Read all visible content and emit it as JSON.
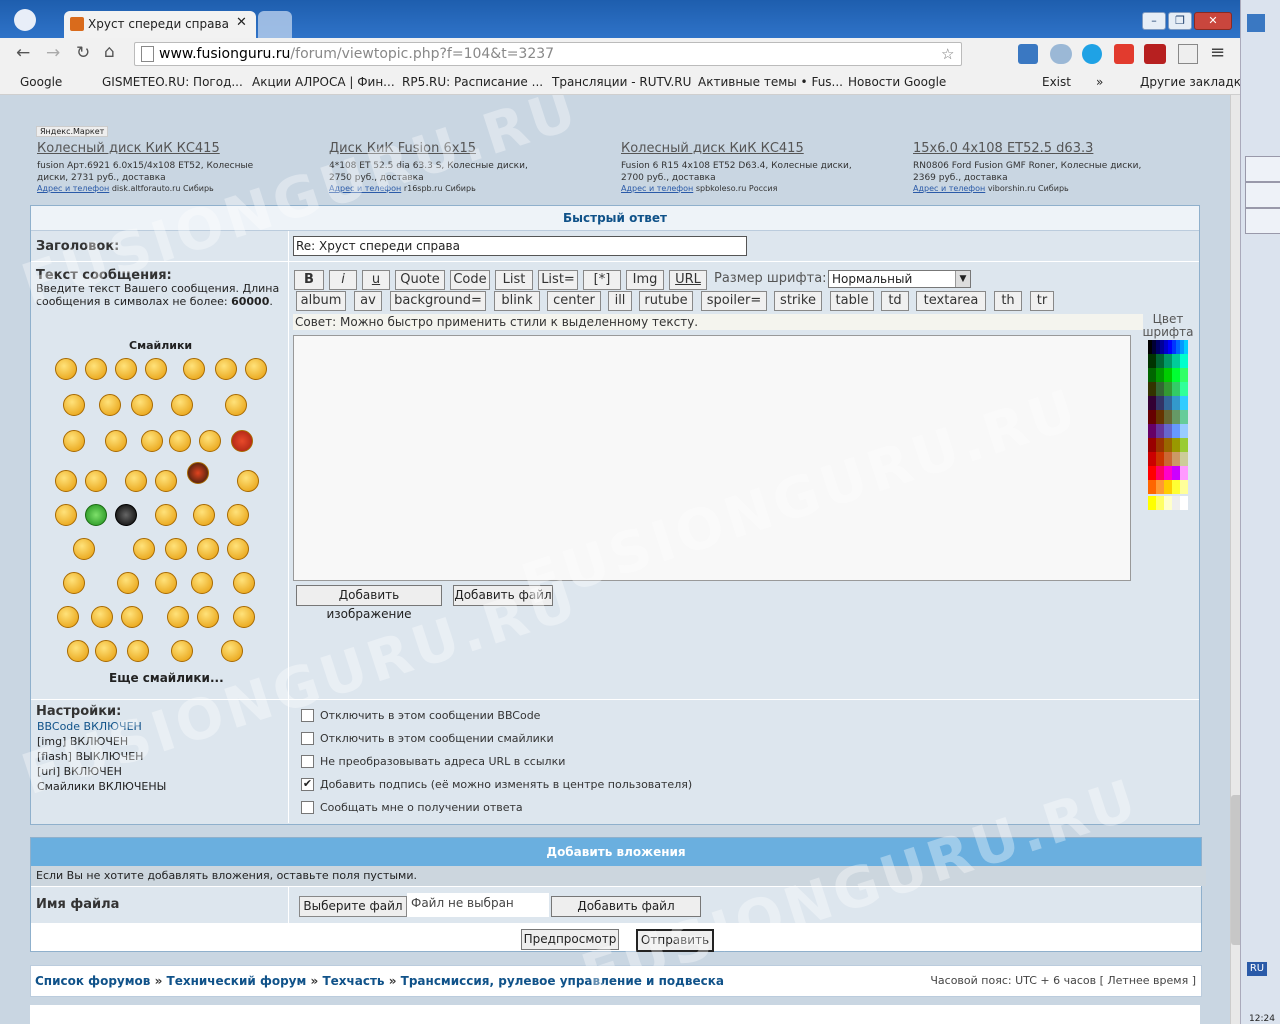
{
  "browser": {
    "tab_title": "Хруст спереди справа • Fu",
    "url_host": "www.fusionguru.ru",
    "url_path": "/forum/viewtopic.php?f=104&t=3237",
    "bookmarks": [
      "Google",
      "GISMETEO.RU: Погод...",
      "Акции АЛРОСА | Фин...",
      "RP5.RU: Расписание ...",
      "Трансляции - RUTV.RU",
      "Активные темы • Fus...",
      "Новости Google",
      "Exist",
      "»",
      "Другие закладки"
    ]
  },
  "ads": {
    "market_label": "Яндекс.Маркет",
    "items": [
      {
        "title": "Колесный диск КиК КС415",
        "desc1": "fusion Арт.6921 6.0x15/4x108 ET52, Колесные",
        "desc2": "диски, 2731 руб., доставка",
        "link": "Адрес и телефон",
        "site": "disk.altforauto.ru Сибирь"
      },
      {
        "title": "Диск КиК Fusion 6x15",
        "desc1": "4*108 ET 52.5 dia 63.3 S, Колесные диски,",
        "desc2": "2750 руб., доставка",
        "link": "Адрес и телефон",
        "site": "r16spb.ru Сибирь"
      },
      {
        "title": "Колесный диск КиК КС415",
        "desc1": "Fusion 6 R15 4x108 ET52 D63.4, Колесные диски,",
        "desc2": "2700 руб., доставка",
        "link": "Адрес и телефон",
        "site": "spbkoleso.ru Россия"
      },
      {
        "title": "15x6.0 4x108 ET52.5 d63.3",
        "desc1": "RN0806 Ford Fusion GMF Roner, Колесные диски,",
        "desc2": "2369 руб., доставка",
        "link": "Адрес и телефон",
        "site": "viborshin.ru Сибирь"
      }
    ]
  },
  "quick_reply": {
    "header": "Быстрый ответ",
    "subject_label": "Заголовок:",
    "subject_value": "Re: Хруст спереди справа",
    "message_label": "Текст сообщения:",
    "message_hint": "Введите текст Вашего сообщения. Длина сообщения в символах не более:",
    "message_limit": "60000",
    "smilies_title": "Смайлики",
    "more_smilies": "Еще смайлики...",
    "bbcode_row1": [
      "B",
      "i",
      "u",
      "Quote",
      "Code",
      "List",
      "List=",
      "[*]",
      "Img",
      "URL"
    ],
    "font_size_label": "Размер шрифта:",
    "font_size_value": "Нормальный",
    "bbcode_row2": [
      "album",
      "av",
      "background=",
      "blink",
      "center",
      "ill",
      "rutube",
      "spoiler=",
      "strike",
      "table",
      "td",
      "textarea",
      "th",
      "tr"
    ],
    "tip": "Совет: Можно быстро применить стили к выделенному тексту.",
    "color_label": "Цвет шрифта",
    "add_image": "Добавить изображение",
    "add_file": "Добавить файл",
    "settings_label": "Настройки:",
    "settings": [
      "BBCode ВКЛЮЧЕН",
      "[img] ВКЛЮЧЕН",
      "[flash] ВЫКЛЮЧЕН",
      "[url] ВКЛЮЧЕН",
      "Смайлики ВКЛЮЧЕНЫ"
    ],
    "options": [
      {
        "label": "Отключить в этом сообщении BBCode",
        "checked": false
      },
      {
        "label": "Отключить в этом сообщении смайлики",
        "checked": false
      },
      {
        "label": "Не преобразовывать адреса URL в ссылки",
        "checked": false
      },
      {
        "label": "Добавить подпись (её можно изменять в центре пользователя)",
        "checked": true
      },
      {
        "label": "Сообщать мне о получении ответа",
        "checked": false
      }
    ]
  },
  "attachments": {
    "header": "Добавить вложения",
    "hint": "Если Вы не хотите добавлять вложения, оставьте поля пустыми.",
    "filename_label": "Имя файла",
    "choose_file": "Выберите файл",
    "no_file": "Файл не выбран",
    "add_file": "Добавить файл",
    "preview": "Предпросмотр",
    "submit": "Отправить"
  },
  "breadcrumb": {
    "items": [
      "Список форумов",
      "Технический форум",
      "Техчасть",
      "Трансмиссия, рулевое управление и подвеска"
    ],
    "sep": "»",
    "timezone": "Часовой пояс: UTC + 6 часов [ Летнее время ]"
  },
  "watermark": "FUSIONGURU.RU",
  "system": {
    "lang": "RU",
    "clock": "12:24"
  }
}
